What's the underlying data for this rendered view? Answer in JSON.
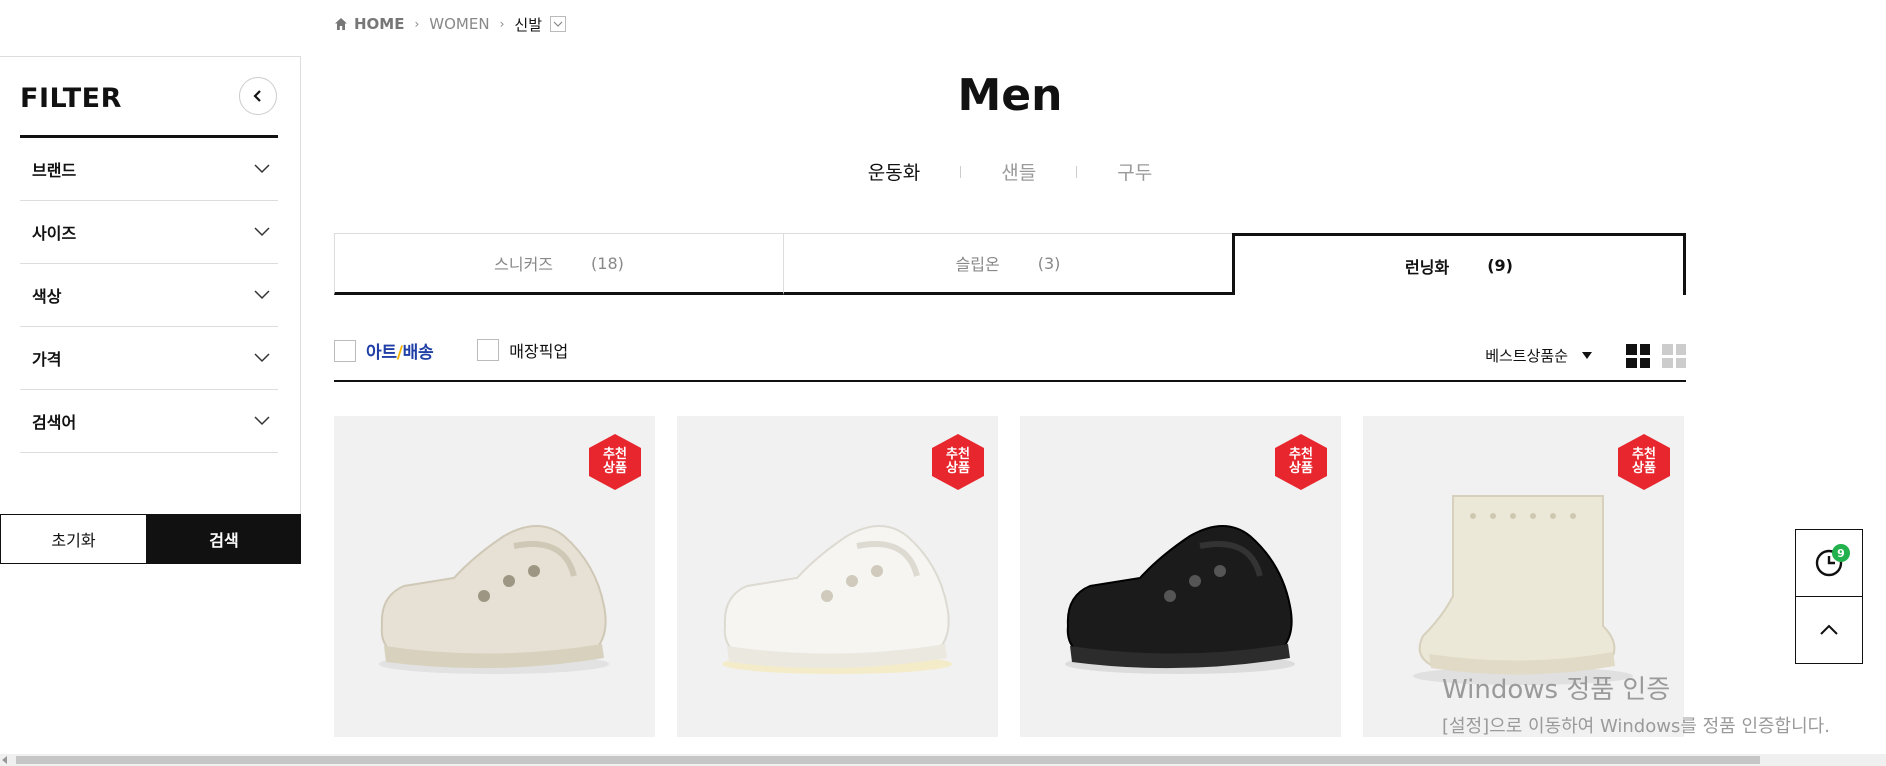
{
  "breadcrumb": {
    "home": "HOME",
    "level1": "WOMEN",
    "current": "신발"
  },
  "sidebar": {
    "title": "FILTER",
    "items": [
      {
        "label": "브랜드"
      },
      {
        "label": "사이즈"
      },
      {
        "label": "색상"
      },
      {
        "label": "가격"
      },
      {
        "label": "검색어"
      }
    ],
    "reset_label": "초기화",
    "search_label": "검색"
  },
  "page_title": "Men",
  "category_tabs": [
    {
      "label": "운동화",
      "active": true
    },
    {
      "label": "샌들",
      "active": false
    },
    {
      "label": "구두",
      "active": false
    }
  ],
  "sub_tabs": [
    {
      "label": "스니커즈",
      "count": "(18)",
      "active": false
    },
    {
      "label": "슬립온",
      "count": "(3)",
      "active": false
    },
    {
      "label": "런닝화",
      "count": "(9)",
      "active": true
    }
  ],
  "toolbar": {
    "art_delivery_a": "아트",
    "art_delivery_b": "배송",
    "store_pickup": "매장픽업",
    "sort_label": "베스트상품순"
  },
  "products": [
    {
      "badge": "추천\n상품",
      "shoe_color": "#e6e1d4"
    },
    {
      "badge": "추천\n상품",
      "shoe_color": "#f6f5f2"
    },
    {
      "badge": "추천\n상품",
      "shoe_color": "#1b1b1b"
    },
    {
      "badge": "추천\n상품",
      "shoe_color": "#ece8d8"
    }
  ],
  "recent_count": "9",
  "watermark": {
    "title": "Windows 정품 인증",
    "subtitle": "[설정]으로 이동하여 Windows를 정품 인증합니다."
  },
  "colors": {
    "badge_red": "#e8262e",
    "art_blue": "#1f3fa6",
    "recent_green": "#22b14c"
  }
}
